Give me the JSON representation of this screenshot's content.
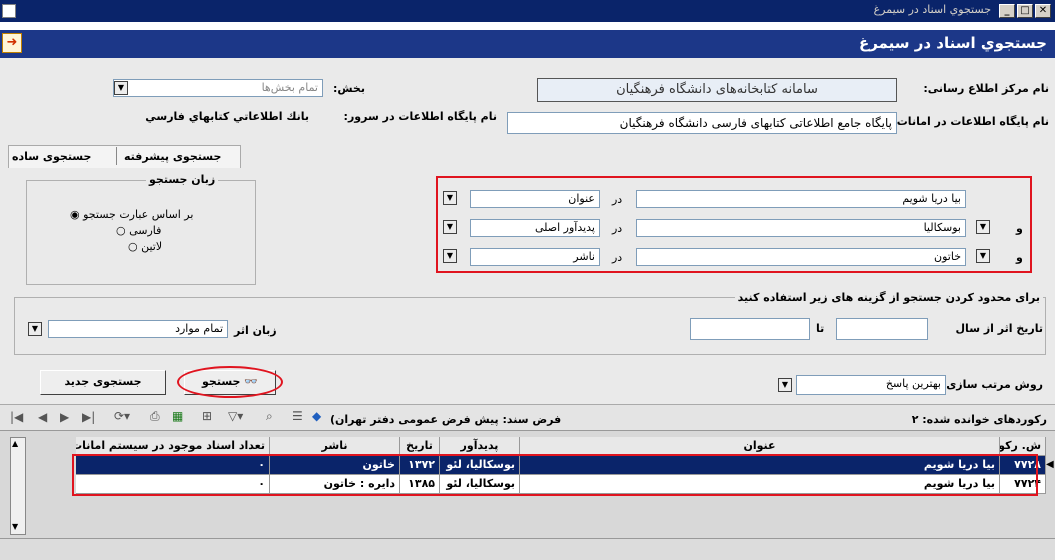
{
  "window": {
    "title": "جستجوي اسناد در سيمرغ"
  },
  "header": {
    "title": "جستجوي اسناد در سيمرغ"
  },
  "form": {
    "center_label": "نام مرکز اطلاع رسانی:",
    "center_value": "سامانه کتابخانه‌های دانشگاه فرهنگیان",
    "db_label": "نام پایگاه اطلاعات در امانات:",
    "db_value": "پایگاه جامع اطلاعاتی کتابهای فارسی دانشگاه فرهنگیان",
    "section_label": "بخش:",
    "section_value": "تمام بخش‌ها",
    "server_db_label": "نام پایگاه اطلاعات در سرور:",
    "server_db_value": "بانك اطلاعاتي كتابهاي فارسي"
  },
  "tabs": [
    {
      "label": "جستجوی ساده"
    },
    {
      "label": "جستجوی پیشرفته"
    }
  ],
  "search_rows": [
    {
      "term": "بیا دریا شویم",
      "in": "در",
      "field": "عنوان",
      "op": ""
    },
    {
      "term": "بوسکالیا",
      "in": "در",
      "field": "پدیدآور اصلی",
      "op": "و"
    },
    {
      "term": "خاتون",
      "in": "در",
      "field": "ناشر",
      "op": "و"
    }
  ],
  "language_group": {
    "title": "زبان جستجو",
    "options": [
      "بر اساس عبارت جستجو",
      "فارسی",
      "لاتین"
    ],
    "selected_index": 0
  },
  "limits": {
    "title": "برای محدود کردن جستجو از گزینه های زیر استفاده کنید",
    "date_label": "تاریخ اثر از سال",
    "to_label": "تا",
    "from_value": "",
    "to_value": "",
    "lang_label": "زبان اثر",
    "lang_value": "تمام موارد"
  },
  "buttons": {
    "search": "جستجو",
    "new_search": "جستجوی جدید"
  },
  "sort": {
    "label": "روش مرتب سازی",
    "value": "بهترین پاسخ"
  },
  "toolbar": {
    "default_doc": "فرض سند: پیش فرض عمومی دفتر تهران)",
    "records_read": "رکوردهای خوانده شده: ۲"
  },
  "grid": {
    "columns": [
      "ش. رکورد",
      "عنوان",
      "پدیدآور",
      "تاریخ",
      "ناشر",
      "تعداد اسناد موجود در سیستم امانات"
    ],
    "rows": [
      [
        "۷۷۲۸",
        "بیا دریا شویم",
        "بوسکالیا، لئو",
        "۱۳۷۲",
        "خاتون",
        "۰"
      ],
      [
        "۷۷۲۴",
        "بیا دریا شویم",
        "بوسکالیا، لئو",
        "۱۳۸۵",
        "دایره : خاتون",
        "۰"
      ]
    ]
  },
  "colors": {
    "titlebar": "#0a246a",
    "header": "#1c3788",
    "highlight": "#e0141f",
    "panel": "#eaeaea"
  }
}
